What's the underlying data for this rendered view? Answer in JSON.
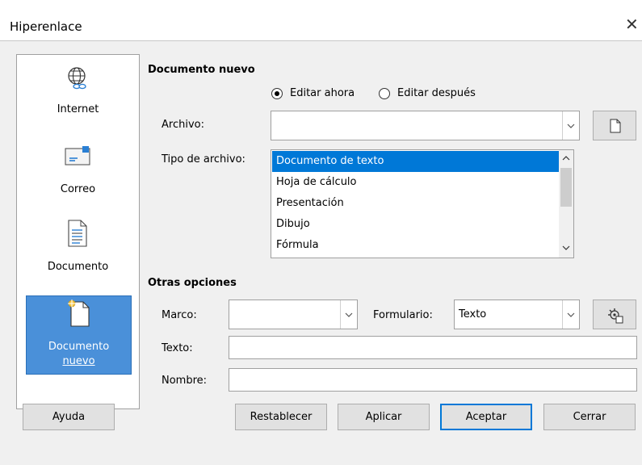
{
  "window": {
    "title": "Hiperenlace",
    "close_glyph": "✕"
  },
  "sidebar": {
    "items": [
      {
        "label": "Internet",
        "icon": "globe-link-icon"
      },
      {
        "label": "Correo",
        "icon": "envelope-icon"
      },
      {
        "label": "Documento",
        "icon": "document-icon"
      },
      {
        "label_line1": "Documento",
        "label_line2": "nuevo",
        "icon": "new-document-icon",
        "selected": true
      }
    ]
  },
  "new_document": {
    "section_title": "Documento nuevo",
    "edit_now_label": "Editar ahora",
    "edit_later_label": "Editar después",
    "edit_now_selected": true,
    "file_label": "Archivo:",
    "file_value": "",
    "file_type_label": "Tipo de archivo:",
    "file_types": [
      "Documento de texto",
      "Hoja de cálculo",
      "Presentación",
      "Dibujo",
      "Fórmula"
    ],
    "selected_file_type": "Documento de texto"
  },
  "other_options": {
    "section_title": "Otras opciones",
    "frame_label": "Marco:",
    "frame_value": "",
    "form_label": "Formulario:",
    "form_value": "Texto",
    "text_label": "Texto:",
    "text_value": "",
    "name_label": "Nombre:",
    "name_value": ""
  },
  "footer": {
    "help": "Ayuda",
    "reset": "Restablecer",
    "apply": "Aplicar",
    "ok": "Aceptar",
    "close": "Cerrar"
  }
}
